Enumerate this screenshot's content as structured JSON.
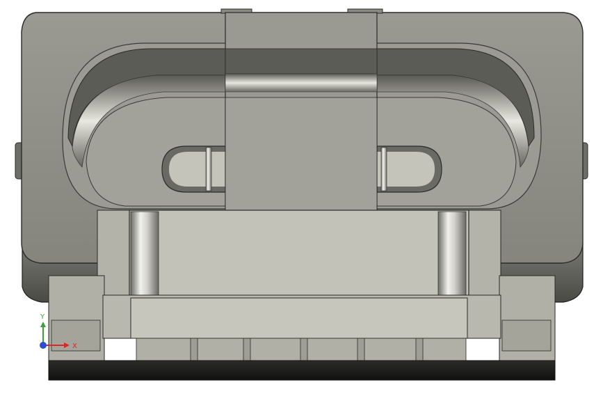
{
  "triad": {
    "x_label": "X",
    "y_label": "Y",
    "x_color": "#d62a2a",
    "y_color": "#3aa13a",
    "z_color": "#2a4fd6"
  },
  "scene": {
    "background": "#ffffff",
    "body_color": "#8e8e86",
    "face_color": "#b5b5ab",
    "dark_color": "#3a3a36"
  }
}
